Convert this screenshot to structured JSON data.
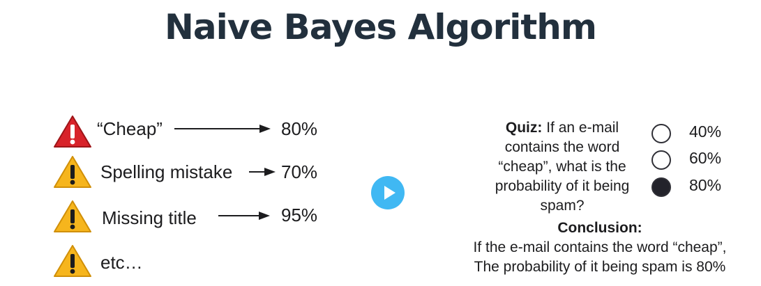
{
  "slide": {
    "title": "Naive Bayes Algorithm"
  },
  "features": [
    {
      "label": "“Cheap”",
      "percent": "80%",
      "icon": "red-warning-icon"
    },
    {
      "label": "Spelling mistake",
      "percent": "70%",
      "icon": "yellow-warning-icon"
    },
    {
      "label": "Missing title",
      "percent": "95%",
      "icon": "yellow-warning-icon"
    },
    {
      "label": "etc…",
      "icon": "yellow-warning-icon"
    }
  ],
  "quiz": {
    "prefix": "Quiz:",
    "question": " If an e-mail contains the word “cheap”, what is the probability of it being spam?",
    "options": [
      {
        "label": "40%",
        "selected": false
      },
      {
        "label": "60%",
        "selected": false
      },
      {
        "label": "80%",
        "selected": true
      }
    ]
  },
  "conclusion": {
    "title": "Conclusion:",
    "line1": "If the e-mail contains the word “cheap”,",
    "line2": "The probability of it being spam is 80%"
  },
  "player": {
    "icon": "play-icon"
  },
  "colors": {
    "title": "#22303d",
    "warning_red": "#d8232a",
    "warning_yellow": "#f6b51d",
    "play_button": "#40b8f3"
  }
}
